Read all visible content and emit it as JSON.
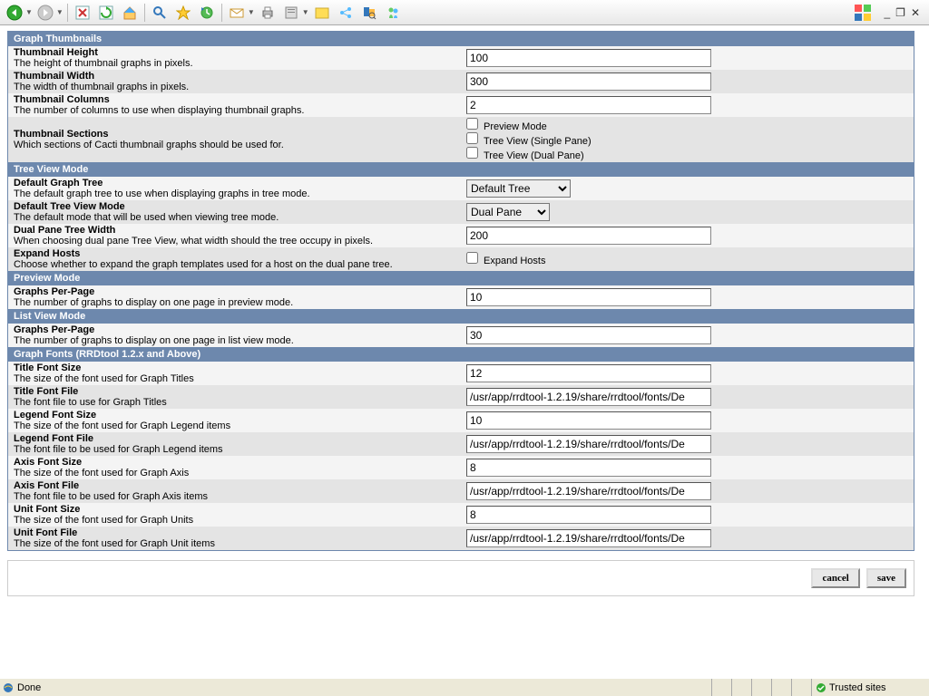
{
  "toolbar": {
    "icons": [
      "back",
      "forward",
      "stop",
      "refresh",
      "home",
      "search",
      "favorites",
      "history",
      "mail",
      "print",
      "edit",
      "folder",
      "share",
      "research",
      "messenger"
    ]
  },
  "windowctrl": {
    "min": "_",
    "restore": "❐",
    "close": "✕"
  },
  "sections": {
    "gt": "Graph Thumbnails",
    "tvm": "Tree View Mode",
    "pm": "Preview Mode",
    "lvm": "List View Mode",
    "gf": "Graph Fonts (RRDtool 1.2.x and Above)"
  },
  "rows": {
    "th": {
      "t": "Thumbnail Height",
      "d": "The height of thumbnail graphs in pixels.",
      "v": "100"
    },
    "tw": {
      "t": "Thumbnail Width",
      "d": "The width of thumbnail graphs in pixels.",
      "v": "300"
    },
    "tc": {
      "t": "Thumbnail Columns",
      "d": "The number of columns to use when displaying thumbnail graphs.",
      "v": "2"
    },
    "ts": {
      "t": "Thumbnail Sections",
      "d": "Which sections of Cacti thumbnail graphs should be used for.",
      "c1": "Preview Mode",
      "c2": "Tree View (Single Pane)",
      "c3": "Tree View (Dual Pane)"
    },
    "dgt": {
      "t": "Default Graph Tree",
      "d": "The default graph tree to use when displaying graphs in tree mode.",
      "v": "Default Tree"
    },
    "dtvm": {
      "t": "Default Tree View Mode",
      "d": "The default mode that will be used when viewing tree mode.",
      "v": "Dual Pane"
    },
    "dptw": {
      "t": "Dual Pane Tree Width",
      "d": "When choosing dual pane Tree View, what width should the tree occupy in pixels.",
      "v": "200"
    },
    "eh": {
      "t": "Expand Hosts",
      "d": "Choose whether to expand the graph templates used for a host on the dual pane tree.",
      "c": "Expand Hosts"
    },
    "gpp": {
      "t": "Graphs Per-Page",
      "d": "The number of graphs to display on one page in preview mode.",
      "v": "10"
    },
    "gpp2": {
      "t": "Graphs Per-Page",
      "d": "The number of graphs to display on one page in list view mode.",
      "v": "30"
    },
    "tfs": {
      "t": "Title Font Size",
      "d": "The size of the font used for Graph Titles",
      "v": "12"
    },
    "tff": {
      "t": "Title Font File",
      "d": "The font file to use for Graph Titles",
      "v": "/usr/app/rrdtool-1.2.19/share/rrdtool/fonts/De"
    },
    "lfs": {
      "t": "Legend Font Size",
      "d": "The size of the font used for Graph Legend items",
      "v": "10"
    },
    "lff": {
      "t": "Legend Font File",
      "d": "The font file to be used for Graph Legend items",
      "v": "/usr/app/rrdtool-1.2.19/share/rrdtool/fonts/De"
    },
    "afs": {
      "t": "Axis Font Size",
      "d": "The size of the font used for Graph Axis",
      "v": "8"
    },
    "aff": {
      "t": "Axis Font File",
      "d": "The font file to be used for Graph Axis items",
      "v": "/usr/app/rrdtool-1.2.19/share/rrdtool/fonts/De"
    },
    "ufs": {
      "t": "Unit Font Size",
      "d": "The size of the font used for Graph Units",
      "v": "8"
    },
    "uff": {
      "t": "Unit Font File",
      "d": "The size of the font used for Graph Unit items",
      "v": "/usr/app/rrdtool-1.2.19/share/rrdtool/fonts/De"
    }
  },
  "buttons": {
    "cancel": "cancel",
    "save": "save"
  },
  "status": {
    "done": "Done",
    "trusted": "Trusted sites"
  }
}
